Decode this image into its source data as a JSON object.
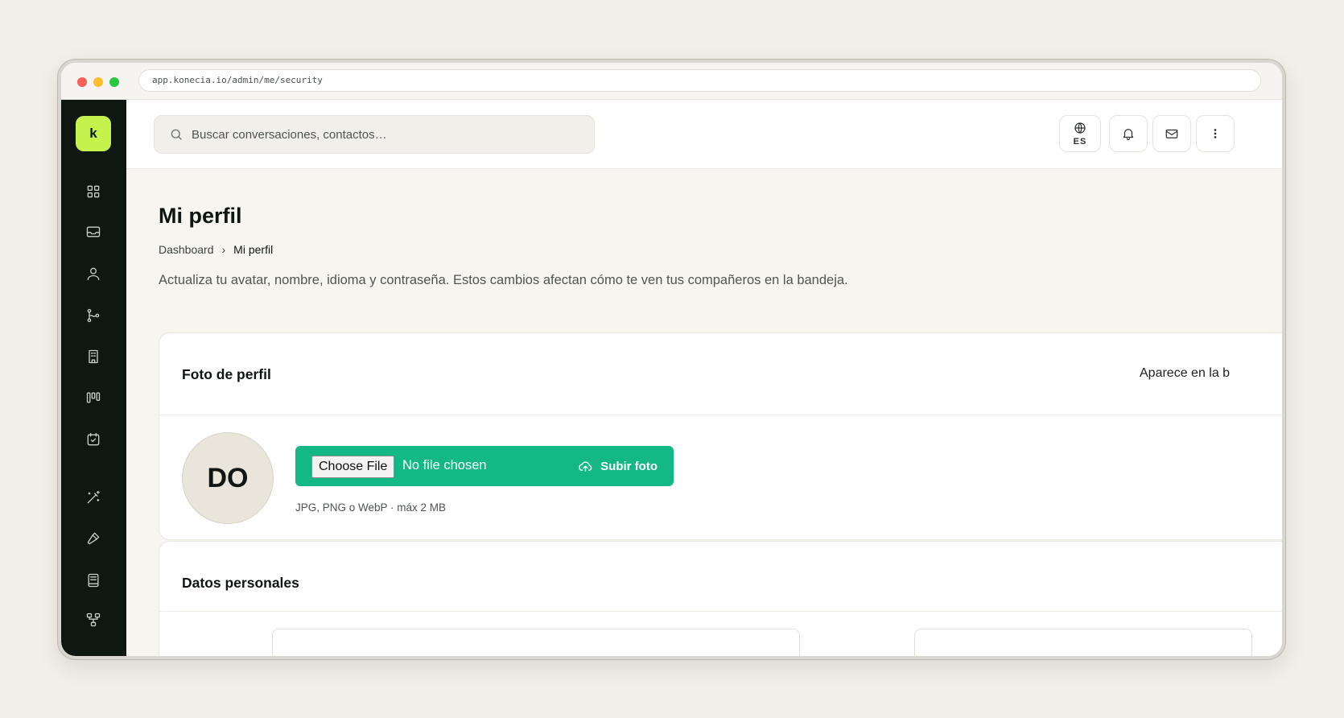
{
  "browser": {
    "url": "app.konecia.io/admin/me/security"
  },
  "sidebar": {
    "logo_letter": "k",
    "items": [
      {
        "icon": "grid-icon"
      },
      {
        "icon": "inbox-icon"
      },
      {
        "icon": "user-icon"
      },
      {
        "icon": "flow-icon"
      },
      {
        "icon": "building-icon"
      },
      {
        "icon": "kanban-icon"
      },
      {
        "icon": "calendar-check-icon"
      },
      {
        "icon": "magic-wand-icon"
      },
      {
        "icon": "hammer-icon"
      },
      {
        "icon": "book-icon"
      },
      {
        "icon": "network-icon"
      }
    ]
  },
  "topbar": {
    "search_placeholder": "Buscar conversaciones, contactos…",
    "language_code": "ES"
  },
  "page": {
    "title": "Mi perfil",
    "breadcrumb": {
      "parent": "Dashboard",
      "current": "Mi perfil"
    },
    "description": "Actualiza tu avatar, nombre, idioma y contraseña. Estos cambios afectan cómo te ven tus compañeros en la bandeja."
  },
  "photo_card": {
    "title": "Foto de perfil",
    "aside": "Aparece en la b",
    "avatar_initials": "DO",
    "choose_file_label": "Choose File",
    "no_file_label": "No file chosen",
    "upload_label": "Subir foto",
    "hint": "JPG, PNG o WebP · máx 2 MB"
  },
  "personal_card": {
    "title": "Datos personales"
  },
  "colors": {
    "sidebar_bg": "#0f1713",
    "logo_accent": "#c6f24e",
    "upload_green": "#14b885",
    "page_bg": "#f7f5f0"
  }
}
